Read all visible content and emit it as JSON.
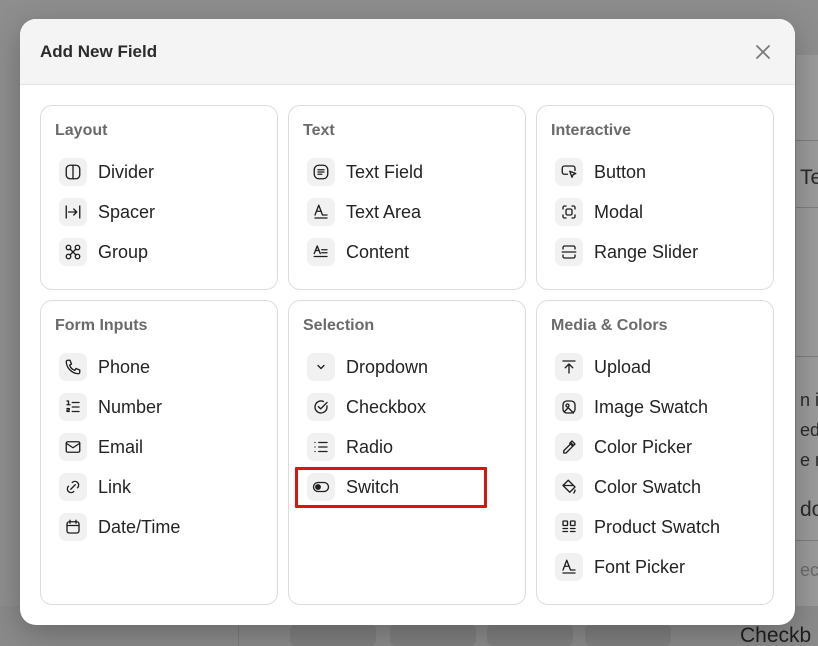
{
  "modal": {
    "title": "Add New Field",
    "close_icon": "close-icon"
  },
  "categories": [
    {
      "title": "Layout",
      "items": [
        {
          "label": "Divider",
          "icon": "divider-icon"
        },
        {
          "label": "Spacer",
          "icon": "spacer-icon"
        },
        {
          "label": "Group",
          "icon": "group-icon"
        }
      ]
    },
    {
      "title": "Text",
      "items": [
        {
          "label": "Text Field",
          "icon": "text-field-icon"
        },
        {
          "label": "Text Area",
          "icon": "text-area-icon"
        },
        {
          "label": "Content",
          "icon": "content-icon"
        }
      ]
    },
    {
      "title": "Interactive",
      "items": [
        {
          "label": "Button",
          "icon": "button-icon"
        },
        {
          "label": "Modal",
          "icon": "modal-icon"
        },
        {
          "label": "Range Slider",
          "icon": "range-slider-icon"
        }
      ]
    },
    {
      "title": "Form Inputs",
      "items": [
        {
          "label": "Phone",
          "icon": "phone-icon"
        },
        {
          "label": "Number",
          "icon": "number-list-icon"
        },
        {
          "label": "Email",
          "icon": "email-icon"
        },
        {
          "label": "Link",
          "icon": "link-icon"
        },
        {
          "label": "Date/Time",
          "icon": "calendar-icon"
        }
      ]
    },
    {
      "title": "Selection",
      "items": [
        {
          "label": "Dropdown",
          "icon": "chevron-down-icon"
        },
        {
          "label": "Checkbox",
          "icon": "check-circle-icon"
        },
        {
          "label": "Radio",
          "icon": "list-icon"
        },
        {
          "label": "Switch",
          "icon": "toggle-icon",
          "highlighted": true
        }
      ]
    },
    {
      "title": "Media & Colors",
      "items": [
        {
          "label": "Upload",
          "icon": "upload-icon"
        },
        {
          "label": "Image Swatch",
          "icon": "image-swatch-icon"
        },
        {
          "label": "Color Picker",
          "icon": "eyedropper-icon"
        },
        {
          "label": "Color Swatch",
          "icon": "paint-bucket-icon"
        },
        {
          "label": "Product Swatch",
          "icon": "product-swatch-icon"
        },
        {
          "label": "Font Picker",
          "icon": "font-picker-icon"
        }
      ]
    }
  ],
  "background": {
    "right_texts": [
      "Te",
      "n ip",
      "ed",
      "e m",
      "do",
      "ect"
    ],
    "bottom_text": "Checkb"
  },
  "colors": {
    "highlight": "#e01111",
    "backdrop": "#8e8e8e"
  }
}
